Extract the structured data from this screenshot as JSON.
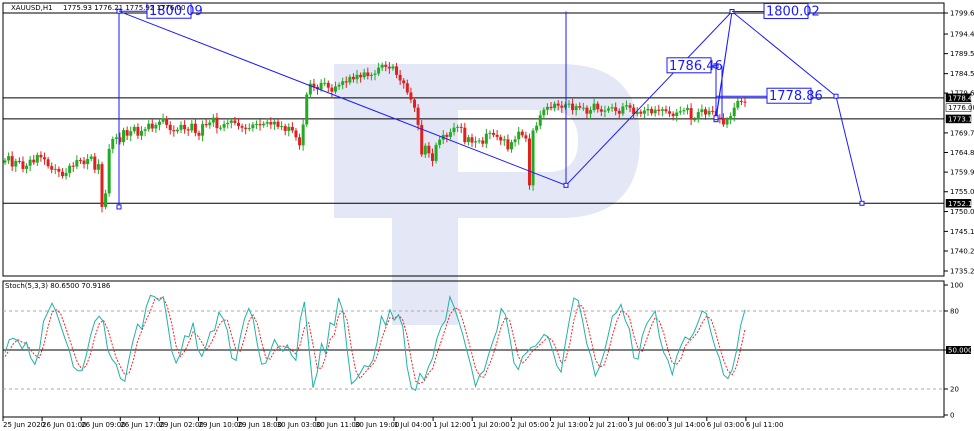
{
  "header": {
    "title": "XAUUSD,H1",
    "ohlc": "1775.93 1776.21 1775.92 1776.00"
  },
  "stoch_header": "Stoch(5,3,3) 80.6500 70.9186",
  "colors": {
    "bull": "#22aa22",
    "bear": "#e02020",
    "stoch_main": "#20b2aa",
    "stoch_signal": "#ff2020",
    "annotation": "#1a1aff",
    "watermark": "#dfe3f4"
  },
  "chart_data": [
    {
      "type": "candlestick",
      "symbol": "XAUUSD",
      "timeframe": "H1",
      "ylim": [
        1733,
        1802
      ],
      "y_ticks": [
        1799.65,
        1794.4,
        1789.5,
        1784.5,
        1779.65,
        1769.7,
        1764.8,
        1759.9,
        1755.0,
        1750.05,
        1745.1,
        1740.2,
        1735.2
      ],
      "x_ticks": [
        "25 Jun 2020",
        "26 Jun 01:00",
        "26 Jun 09:00",
        "26 Jun 17:00",
        "29 Jun 02:00",
        "29 Jun 10:00",
        "29 Jun 18:00",
        "30 Jun 03:00",
        "30 Jun 11:00",
        "30 Jun 19:00",
        "1 Jul 04:00",
        "1 Jul 12:00",
        "1 Jul 20:00",
        "2 Jul 05:00",
        "2 Jul 13:00",
        "2 Jul 21:00",
        "3 Jul 06:00",
        "3 Jul 14:00",
        "6 Jul 03:00",
        "6 Jul 11:00"
      ],
      "price_tags": [
        {
          "value": 1778.45,
          "style": "plain"
        },
        {
          "value": 1776.0,
          "style": "current"
        },
        {
          "value": 1773.19,
          "style": "plain"
        },
        {
          "value": 1752.11,
          "style": "plain"
        }
      ],
      "horizontal_lines": [
        1799.65,
        1778.45,
        1773.19,
        1752.11
      ],
      "series_close": [
        1762.8,
        1763.9,
        1761.3,
        1762.7,
        1762.6,
        1760.7,
        1761.5,
        1763.0,
        1762.3,
        1764.2,
        1763.6,
        1763.1,
        1761.4,
        1760.5,
        1760.7,
        1760.0,
        1758.9,
        1759.7,
        1761.5,
        1761.3,
        1762.9,
        1762.8,
        1761.9,
        1763.2,
        1763.8,
        1760.5,
        1761.9,
        1751.2,
        1754.6,
        1765.7,
        1768.2,
        1768.6,
        1767.4,
        1770.4,
        1769.0,
        1770.1,
        1771.2,
        1769.0,
        1770.2,
        1770.6,
        1772.0,
        1770.8,
        1771.7,
        1772.5,
        1773.3,
        1771.7,
        1770.4,
        1770.1,
        1770.5,
        1771.7,
        1770.6,
        1770.3,
        1772.0,
        1769.7,
        1769.0,
        1771.9,
        1771.6,
        1772.3,
        1773.5,
        1770.9,
        1771.0,
        1771.9,
        1772.2,
        1772.8,
        1772.2,
        1771.4,
        1771.0,
        1770.7,
        1770.9,
        1771.8,
        1771.9,
        1771.6,
        1772.0,
        1772.4,
        1771.8,
        1772.5,
        1771.2,
        1771.4,
        1770.2,
        1771.2,
        1770.3,
        1768.6,
        1766.6,
        1771.8,
        1779.3,
        1782.0,
        1781.2,
        1780.6,
        1782.2,
        1782.2,
        1781.0,
        1780.0,
        1781.3,
        1781.7,
        1782.6,
        1782.3,
        1783.7,
        1783.1,
        1784.2,
        1783.6,
        1784.8,
        1783.9,
        1784.2,
        1784.5,
        1786.0,
        1786.7,
        1786.2,
        1785.8,
        1786.3,
        1784.2,
        1782.8,
        1782.1,
        1779.8,
        1778.0,
        1776.0,
        1771.7,
        1764.3,
        1766.5,
        1764.6,
        1762.7,
        1766.7,
        1768.0,
        1769.2,
        1768.7,
        1769.9,
        1771.0,
        1771.2,
        1771.0,
        1767.4,
        1768.6,
        1767.3,
        1767.6,
        1767.8,
        1767.0,
        1769.5,
        1769.7,
        1769.2,
        1768.7,
        1767.8,
        1768.1,
        1765.6,
        1767.4,
        1768.1,
        1770.0,
        1769.1,
        1768.3,
        1756.6,
        1770.3,
        1771.5,
        1774.1,
        1775.5,
        1776.2,
        1775.9,
        1777.0,
        1776.5,
        1776.0,
        1776.8,
        1777.0,
        1775.4,
        1776.4,
        1776.0,
        1776.0,
        1774.5,
        1775.4,
        1777.0,
        1775.6,
        1775.0,
        1775.3,
        1775.8,
        1776.1,
        1775.2,
        1774.5,
        1776.3,
        1776.6,
        1776.0,
        1774.4,
        1775.0,
        1774.5,
        1775.3,
        1775.7,
        1774.6,
        1775.5,
        1775.2,
        1775.6,
        1775.1,
        1774.5,
        1773.9,
        1774.8,
        1775.1,
        1775.4,
        1775.9,
        1773.0,
        1773.1,
        1774.9,
        1775.6,
        1774.3,
        1775.2,
        1775.1,
        1773.5,
        1773.4,
        1771.8,
        1773.0,
        1773.9,
        1776.0,
        1777.7,
        1777.5,
        1777.3
      ],
      "bars_count": 208,
      "indicator": {
        "name": "Stoch(5,3,3)",
        "main": 80.65,
        "signal": 70.9186,
        "ylim": [
          0,
          100
        ],
        "y_ticks": [
          100,
          80,
          50.0,
          20,
          0
        ],
        "levels": [
          80,
          50,
          20
        ],
        "main_series": [
          48,
          58,
          59,
          57,
          51,
          56,
          44,
          39,
          49,
          72,
          79,
          86,
          79,
          69,
          59,
          50,
          37,
          34,
          34,
          46,
          61,
          72,
          76,
          72,
          50,
          43,
          39,
          28,
          26,
          43,
          58,
          70,
          66,
          83,
          92,
          91,
          88,
          91,
          71,
          49,
          40,
          47,
          61,
          60,
          71,
          51,
          45,
          53,
          64,
          65,
          79,
          74,
          65,
          44,
          42,
          60,
          74,
          82,
          74,
          54,
          39,
          40,
          49,
          58,
          52,
          49,
          54,
          46,
          42,
          73,
          87,
          54,
          21,
          33,
          55,
          47,
          71,
          69,
          90,
          80,
          50,
          24,
          27,
          32,
          38,
          37,
          42,
          56,
          76,
          69,
          81,
          73,
          77,
          68,
          37,
          21,
          19,
          32,
          27,
          37,
          44,
          59,
          68,
          73,
          91,
          83,
          73,
          62,
          49,
          37,
          22,
          31,
          34,
          46,
          56,
          65,
          82,
          77,
          60,
          40,
          35,
          45,
          48,
          52,
          53,
          57,
          62,
          60,
          50,
          38,
          33,
          55,
          74,
          90,
          88,
          73,
          55,
          45,
          30,
          37,
          47,
          61,
          76,
          79,
          85,
          73,
          66,
          44,
          43,
          61,
          70,
          75,
          80,
          60,
          48,
          42,
          31,
          45,
          53,
          60,
          58,
          63,
          71,
          80,
          78,
          64,
          52,
          44,
          31,
          28,
          35,
          49,
          69,
          81
        ],
        "signal_series": [
          45,
          50,
          55,
          58,
          56,
          55,
          50,
          46,
          44,
          53,
          67,
          79,
          81,
          78,
          69,
          59,
          49,
          40,
          35,
          38,
          47,
          60,
          70,
          73,
          66,
          55,
          44,
          37,
          31,
          32,
          42,
          57,
          65,
          73,
          80,
          89,
          90,
          90,
          83,
          70,
          53,
          45,
          49,
          56,
          64,
          61,
          56,
          50,
          54,
          61,
          69,
          73,
          73,
          61,
          50,
          49,
          59,
          72,
          77,
          70,
          56,
          44,
          43,
          49,
          53,
          53,
          52,
          50,
          47,
          54,
          67,
          71,
          54,
          36,
          36,
          45,
          58,
          62,
          77,
          80,
          73,
          51,
          34,
          28,
          32,
          36,
          39,
          45,
          58,
          67,
          75,
          74,
          77,
          73,
          61,
          42,
          26,
          24,
          26,
          32,
          36,
          47,
          57,
          67,
          77,
          82,
          82,
          73,
          61,
          49,
          36,
          30,
          29,
          37,
          45,
          56,
          68,
          75,
          73,
          59,
          45,
          40,
          43,
          48,
          51,
          54,
          57,
          60,
          57,
          50,
          40,
          42,
          54,
          73,
          84,
          84,
          72,
          58,
          43,
          37,
          38,
          48,
          61,
          72,
          80,
          79,
          75,
          61,
          51,
          49,
          58,
          68,
          75,
          72,
          63,
          50,
          40,
          39,
          43,
          53,
          57,
          60,
          64,
          71,
          76,
          74,
          65,
          53,
          42,
          34,
          31,
          37,
          51,
          66
        ]
      },
      "annotations": [
        {
          "label": "1800.09",
          "value": 1800.09
        },
        {
          "label": "1800.02",
          "value": 1800.02
        },
        {
          "label": "1786.46",
          "value": 1786.46
        },
        {
          "label": "1778.86",
          "value": 1778.86
        }
      ],
      "forecast_path": [
        1751.2,
        1800.09,
        1756.6,
        1800.02,
        1773.0,
        1786.46,
        1773.5,
        1800.02,
        1778.86,
        1752.11
      ],
      "grid": false
    }
  ]
}
